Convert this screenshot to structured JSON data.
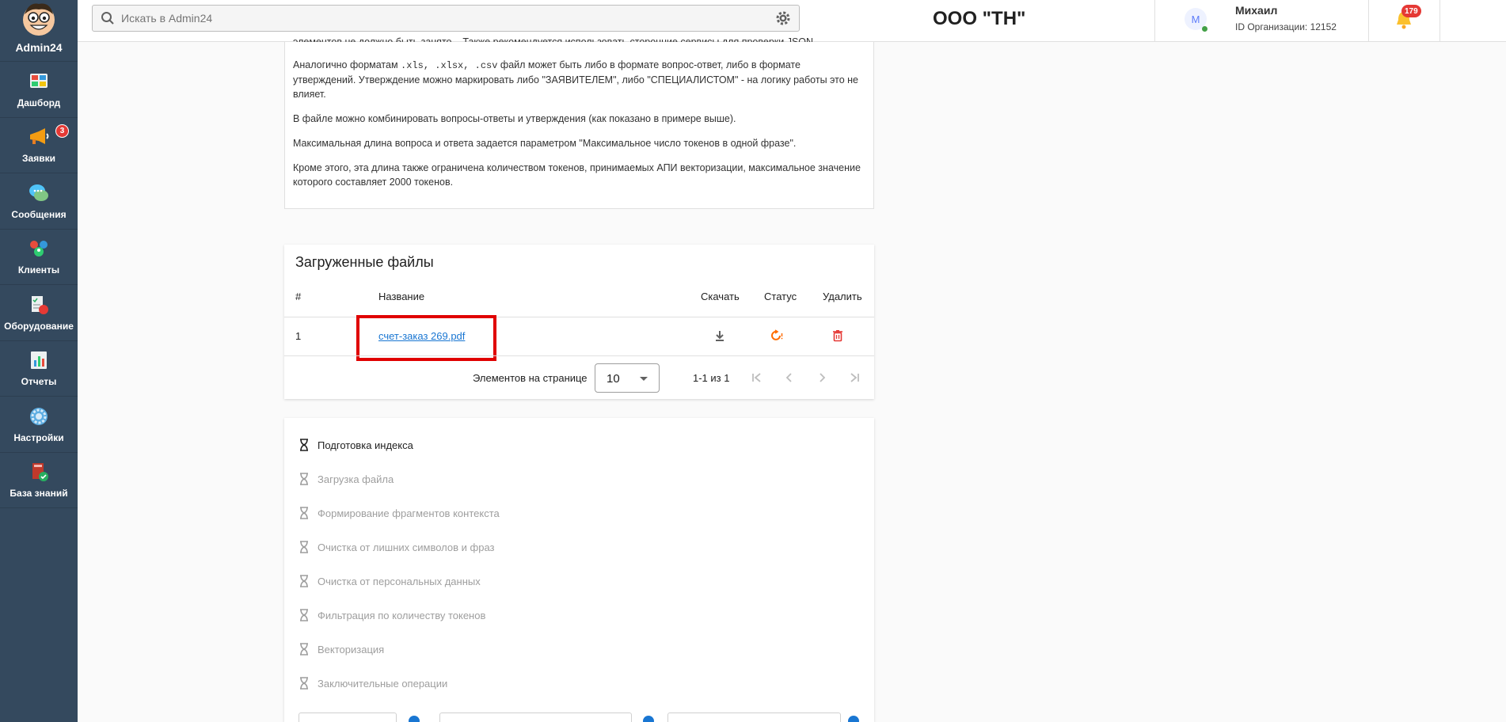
{
  "app": {
    "name": "Admin24",
    "colors": {
      "sidebar": "#34495e",
      "accent": "#1976d2",
      "danger": "#e53935",
      "highlight": "#e00000"
    }
  },
  "sidebar": {
    "items": [
      {
        "label": "Дашборд",
        "icon": "dashboard-icon"
      },
      {
        "label": "Заявки",
        "icon": "megaphone-icon",
        "badge": "3"
      },
      {
        "label": "Сообщения",
        "icon": "chat-icon"
      },
      {
        "label": "Клиенты",
        "icon": "clients-icon"
      },
      {
        "label": "Оборудование",
        "icon": "equipment-icon"
      },
      {
        "label": "Отчеты",
        "icon": "reports-icon"
      },
      {
        "label": "Настройки",
        "icon": "gear-icon"
      },
      {
        "label": "База знаний",
        "icon": "knowledge-base-icon"
      }
    ]
  },
  "header": {
    "search_placeholder": "Искать в Admin24",
    "org_title": "ООО \"ТН\"",
    "user": {
      "initial": "М",
      "name": "Михаил",
      "org_id": "ID Организации: 12152"
    },
    "notifications": "179",
    "help": "?"
  },
  "info": {
    "cut_line": "элементов не должно быть занято... Также рекомендуется использовать сторонние сервисы для проверки JSON.",
    "p1_a": "Аналогично форматам ",
    "p1_code": ".xls, .xlsx, .csv",
    "p1_b": " файл может быть либо в формате вопрос-ответ, либо в формате утверждений. Утверждение можно маркировать либо \"ЗАЯВИТЕЛЕМ\", либо \"СПЕЦИАЛИСТОМ\" - на логику работы это не влияет.",
    "p2": "В файле можно комбинировать вопросы-ответы и утверждения (как показано в примере выше).",
    "p3": "Максимальная длина вопроса и ответа задается параметром \"Максимальное число токенов в одной фразе\".",
    "p4": "Кроме этого, эта длина также ограничена количеством токенов, принимаемых АПИ векторизации, максимальное значение которого составляет 2000 токенов."
  },
  "files": {
    "title": "Загруженные файлы",
    "columns": {
      "num": "#",
      "name": "Название",
      "download": "Скачать",
      "status": "Статус",
      "delete": "Удалить"
    },
    "rows": [
      {
        "num": "1",
        "name": "счет-заказ 269.pdf",
        "status_icon": "processing-icon"
      }
    ],
    "pager": {
      "label": "Элементов на странице",
      "page_size": "10",
      "range": "1-1 из 1"
    }
  },
  "steps": [
    {
      "label": "Подготовка индекса",
      "active": true
    },
    {
      "label": "Загрузка файла",
      "active": false
    },
    {
      "label": "Формирование фрагментов контекста",
      "active": false
    },
    {
      "label": "Очистка от лишних символов и фраз",
      "active": false
    },
    {
      "label": "Очистка от персональных данных",
      "active": false
    },
    {
      "label": "Фильтрация по количеству токенов",
      "active": false
    },
    {
      "label": "Векторизация",
      "active": false
    },
    {
      "label": "Заключительные операции",
      "active": false
    }
  ]
}
